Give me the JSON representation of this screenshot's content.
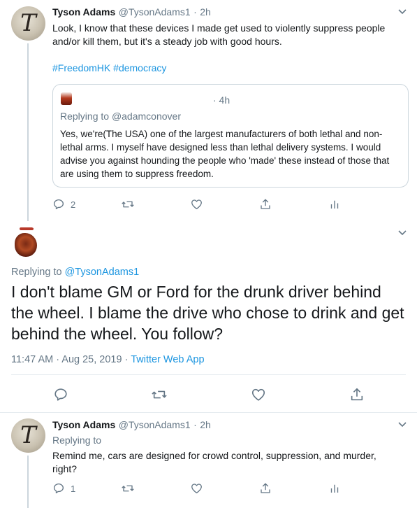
{
  "tweet1": {
    "display_name": "Tyson Adams",
    "handle": "@TysonAdams1",
    "sep": "·",
    "time": "2h",
    "body": "Look, I know that these devices I made get used to violently suppress people and/or kill them, but it's a steady job with good hours.",
    "hashtags": [
      "#FreedomHK",
      "#democracy"
    ],
    "quoted": {
      "time": "· 4h",
      "replying_prefix": "Replying to",
      "replying_handle": "@adamconover",
      "body": "Yes, we're(The USA) one of the largest manufacturers of both lethal and non-lethal arms. I myself have designed less than lethal delivery systems. I would advise you against hounding the people who 'made' these instead of those that are using them to suppress freedom."
    },
    "actions": {
      "reply_count": "2",
      "retweet_count": "",
      "like_count": ""
    }
  },
  "focal": {
    "replying_prefix": "Replying to",
    "replying_handle": "@TysonAdams1",
    "body_line1": "I don't blame GM or Ford for the drunk driver behind",
    "body_line2": "the wheel. I blame the drive who chose to drink and get",
    "body_line3": "behind the wheel. You follow?",
    "timestamp": "11:47 AM · Aug 25, 2019",
    "sep": "·",
    "source": "Twitter Web App"
  },
  "tweet3": {
    "display_name": "Tyson Adams",
    "handle": "@TysonAdams1",
    "sep": "·",
    "time": "2h",
    "replying_label": "Replying to",
    "body": "Remind me, cars are designed for crowd control, suppression, and murder, right?",
    "actions": {
      "reply_count": "1"
    }
  },
  "colors": {
    "accent": "#1b95e0",
    "muted": "#657786",
    "border": "#e6ecf0"
  },
  "icons": [
    "chevron-down-icon",
    "reply-icon",
    "retweet-icon",
    "like-icon",
    "share-icon",
    "analytics-icon"
  ]
}
